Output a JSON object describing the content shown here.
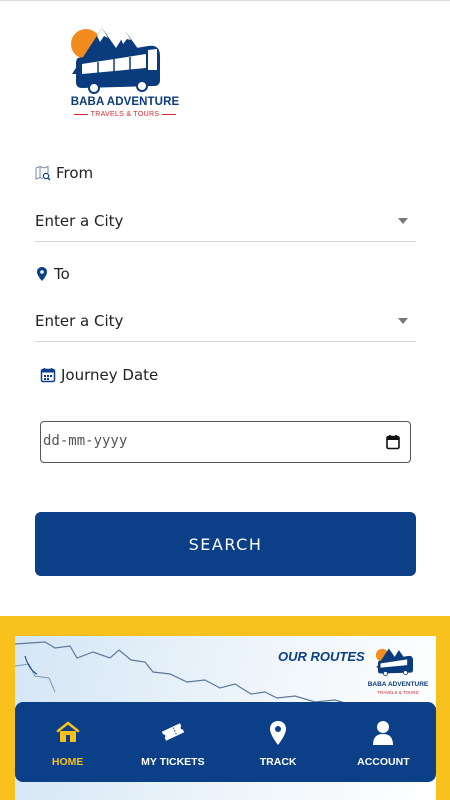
{
  "brand": {
    "name": "BABA ADVENTURE",
    "tagline": "TRAVELS & TOURS"
  },
  "form": {
    "from": {
      "label": "From",
      "value": "Enter a City",
      "icon": "map-search-icon"
    },
    "to": {
      "label": "To",
      "value": "Enter a City",
      "icon": "location-pin-icon"
    },
    "date": {
      "label": "Journey Date",
      "placeholder": "dd-mm-yyyy",
      "icon": "calendar-icon"
    },
    "search_label": "SEARCH"
  },
  "banner": {
    "heading": "OUR ROUTES",
    "brand_name": "BABA ADVENTURE",
    "brand_tagline": "TRAVELS & TOURS"
  },
  "nav": {
    "items": [
      {
        "label": "HOME",
        "icon": "home-icon",
        "active": true
      },
      {
        "label": "MY TICKETS",
        "icon": "ticket-icon",
        "active": false
      },
      {
        "label": "TRACK",
        "icon": "location-pin-icon",
        "active": false
      },
      {
        "label": "ACCOUNT",
        "icon": "user-icon",
        "active": false
      }
    ]
  },
  "colors": {
    "primary": "#0b3f87",
    "accent": "#f9c11d",
    "brand_red": "#d9262e"
  }
}
